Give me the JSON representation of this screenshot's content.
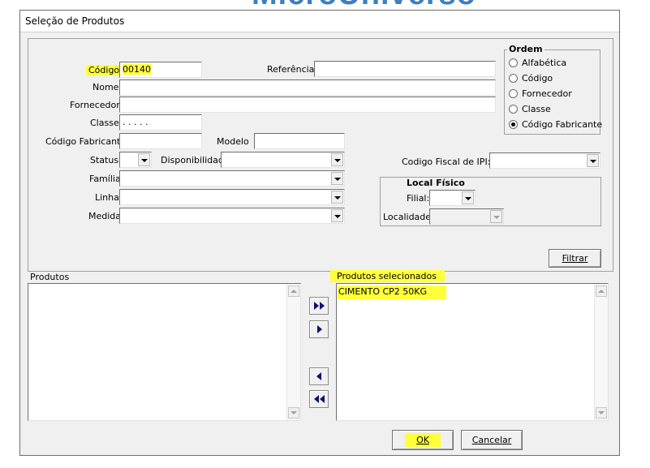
{
  "background_logo": {
    "text": "MicroUniverso",
    "color": "#3c7fc0"
  },
  "window": {
    "title": "Seleção de Produtos"
  },
  "form": {
    "codigo": {
      "label": "Código",
      "value": "00140"
    },
    "referencia": {
      "label": "Referência",
      "value": ""
    },
    "nome": {
      "label": "Nome",
      "value": ""
    },
    "fornecedor": {
      "label": "Fornecedor",
      "value": ""
    },
    "classe": {
      "label": "Classe",
      "value": ". . . . ."
    },
    "codigo_fabricante": {
      "label": "Código Fabricante",
      "value": ""
    },
    "modelo": {
      "label": "Modelo",
      "value": ""
    },
    "status": {
      "label": "Status",
      "value": ""
    },
    "disponibilidade": {
      "label": "Disponibilidade",
      "value": ""
    },
    "codigo_fiscal_ipi": {
      "label": "Codigo Fiscal de IPI:",
      "value": ""
    },
    "familia": {
      "label": "Família",
      "value": ""
    },
    "linha": {
      "label": "Linha",
      "value": ""
    },
    "medida": {
      "label": "Medida",
      "value": ""
    }
  },
  "ordem": {
    "title": "Ordem",
    "options": [
      "Alfabética",
      "Código",
      "Fornecedor",
      "Classe",
      "Código Fabricante"
    ],
    "selected": "Código Fabricante"
  },
  "local_fisico": {
    "title": "Local Físico",
    "filial_label": "Filial:",
    "filial_value": "",
    "localidade_label": "Localidade:",
    "localidade_value": ""
  },
  "filter_button": {
    "label": "Filtrar"
  },
  "produtos": {
    "label": "Produtos",
    "items": []
  },
  "produtos_selecionados": {
    "label": "Produtos selecionados",
    "items": [
      "CIMENTO CP2 50KG"
    ]
  },
  "transfer_buttons": [
    "add-all",
    "add-one",
    "remove-one",
    "remove-all"
  ],
  "ok_button": {
    "label": "OK"
  },
  "cancel_button": {
    "label": "Cancelar"
  },
  "highlight_color": "#ffff3c"
}
